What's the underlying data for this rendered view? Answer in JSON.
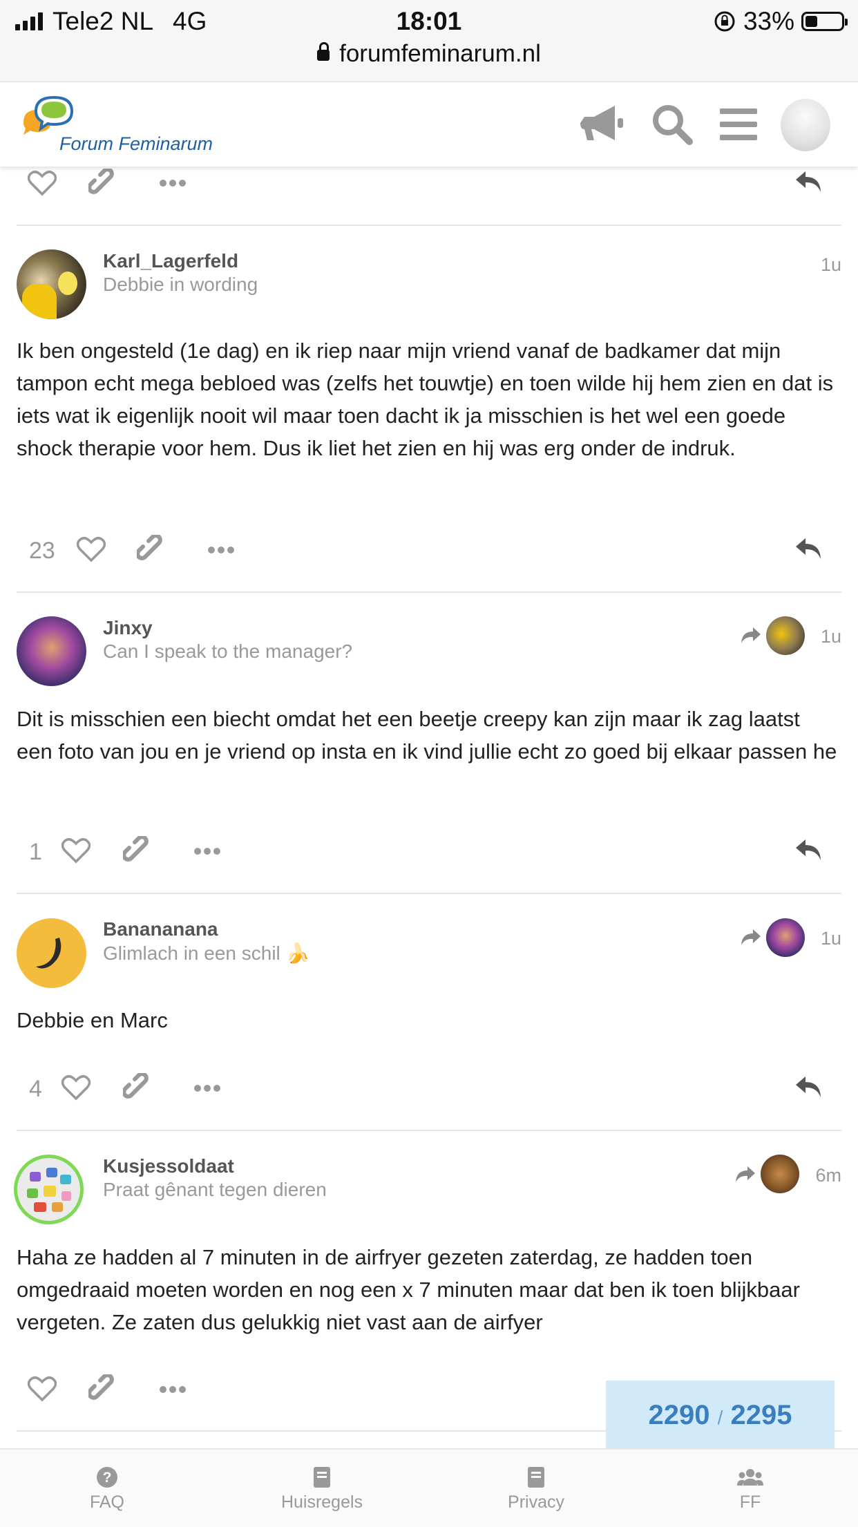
{
  "status_bar": {
    "carrier": "Tele2 NL",
    "network": "4G",
    "time": "18:01",
    "battery": "33%",
    "battery_level": 0.33,
    "url": "forumfeminarum.nl"
  },
  "header": {
    "logo_text": "Forum Feminarum"
  },
  "top_actions": {},
  "posts": [
    {
      "username": "Karl_Lagerfeld",
      "user_title": "Debbie in wording",
      "time": "1u",
      "body": "Ik ben ongesteld (1e dag) en ik riep naar mijn vriend vanaf de badkamer dat mijn tampon echt mega bebloed was (zelfs het touwtje) en toen wilde hij hem zien en dat is iets wat ik eigenlijk nooit wil maar toen dacht ik ja misschien is het wel een goede shock therapie voor hem. Dus ik liet het zien en hij was erg onder de indruk.",
      "likes": "23"
    },
    {
      "username": "Jinxy",
      "user_title": "Can I speak to the manager?",
      "time": "1u",
      "body": "Dit is misschien een biecht omdat het een beetje creepy kan zijn maar ik zag laatst een foto van jou en je vriend op insta en ik vind jullie echt zo goed bij elkaar passen he",
      "likes": "1"
    },
    {
      "username": "Banananana",
      "user_title": "Glimlach in een schil 🍌",
      "time": "1u",
      "body": "Debbie en Marc",
      "likes": "4"
    },
    {
      "username": "Kusjessoldaat",
      "user_title": "Praat gênant tegen dieren",
      "time": "6m",
      "body": "Haha ze hadden al 7 minuten in de airfryer gezeten zaterdag, ze hadden toen omgedraaid moeten worden en nog een x 7 minuten maar dat ben ik toen blijkbaar vergeten. Ze zaten dus gelukkig niet vast aan de airfyer",
      "likes": ""
    }
  ],
  "progress": {
    "current": "2290",
    "separator": "/",
    "total": "2295"
  },
  "footer": {
    "items": [
      {
        "label": "FAQ"
      },
      {
        "label": "Huisregels"
      },
      {
        "label": "Privacy"
      },
      {
        "label": "FF"
      }
    ]
  },
  "colors": {
    "accent": "#3a7ec0",
    "progress_bg": "#d1eaf9",
    "icon_gray": "#999999"
  }
}
